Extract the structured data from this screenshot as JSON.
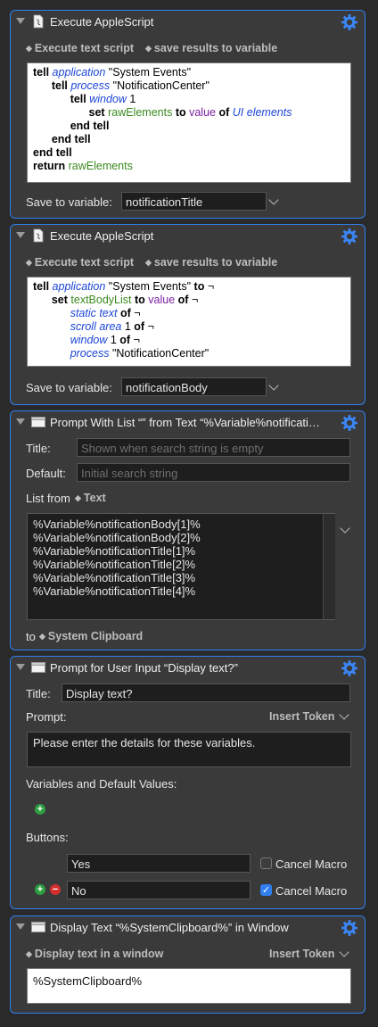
{
  "actions": [
    {
      "title": "Execute AppleScript",
      "popup_left": "Execute text script",
      "popup_right": "save results to variable",
      "save_label": "Save to variable:",
      "variable": "notificationTitle"
    },
    {
      "title": "Execute AppleScript",
      "popup_left": "Execute text script",
      "popup_right": "save results to variable",
      "save_label": "Save to variable:",
      "variable": "notificationBody"
    },
    {
      "title": "Prompt With List “” from Text “%Variable%notificati…",
      "title_label": "Title:",
      "title_placeholder": "Shown when search string is empty",
      "default_label": "Default:",
      "default_placeholder": "Initial search string",
      "list_from_label": "List from",
      "list_from_value": "Text",
      "list_items": [
        "%Variable%notificationBody[1]%",
        "%Variable%notificationBody[2]%",
        "%Variable%notificationTitle[1]%",
        "%Variable%notificationTitle[2]%",
        "%Variable%notificationTitle[3]%",
        "%Variable%notificationTitle[4]%"
      ],
      "to_label": "to",
      "to_value": "System Clipboard"
    },
    {
      "title": "Prompt for User Input “Display text?”",
      "title_label": "Title:",
      "title_value": "Display text?",
      "prompt_label": "Prompt:",
      "insert_token": "Insert Token",
      "prompt_value": "Please enter the details for these variables.",
      "vars_label": "Variables and Default Values:",
      "buttons_label": "Buttons:",
      "buttons": [
        {
          "name": "Yes",
          "cancel_label": "Cancel Macro",
          "cancel_checked": false
        },
        {
          "name": "No",
          "cancel_label": "Cancel Macro",
          "cancel_checked": true
        }
      ]
    },
    {
      "title": "Display Text “%SystemClipboard%” in Window",
      "popup_left": "Display text in a window",
      "insert_token": "Insert Token",
      "text_value": "%SystemClipboard%"
    }
  ],
  "script1": {
    "l1": [
      "tell",
      "application",
      "\"System Events\""
    ],
    "l2": [
      "tell",
      "process",
      "\"NotificationCenter\""
    ],
    "l3": [
      "tell",
      "window",
      "1"
    ],
    "l4": [
      "set",
      "rawElements",
      "to",
      "value",
      "of",
      "UI elements"
    ],
    "l5": [
      "end tell"
    ],
    "l6": [
      "end tell"
    ],
    "l7": [
      "end tell"
    ],
    "l8": [
      "return",
      "rawElements"
    ]
  },
  "script2": {
    "l1": [
      "tell",
      "application",
      "\"System Events\"",
      "to",
      "¬"
    ],
    "l2": [
      "set",
      "textBodyList",
      "to",
      "value",
      "of",
      "¬"
    ],
    "l3": [
      "static text",
      "of",
      "¬"
    ],
    "l4": [
      "scroll area",
      "1",
      "of",
      "¬"
    ],
    "l5": [
      "window",
      "1",
      "of",
      "¬"
    ],
    "l6": [
      "process",
      "\"NotificationCenter\""
    ]
  },
  "colors": {
    "accent": "#2f7ff0",
    "panel": "#3a3a3a",
    "background": "#2a2a2a"
  }
}
